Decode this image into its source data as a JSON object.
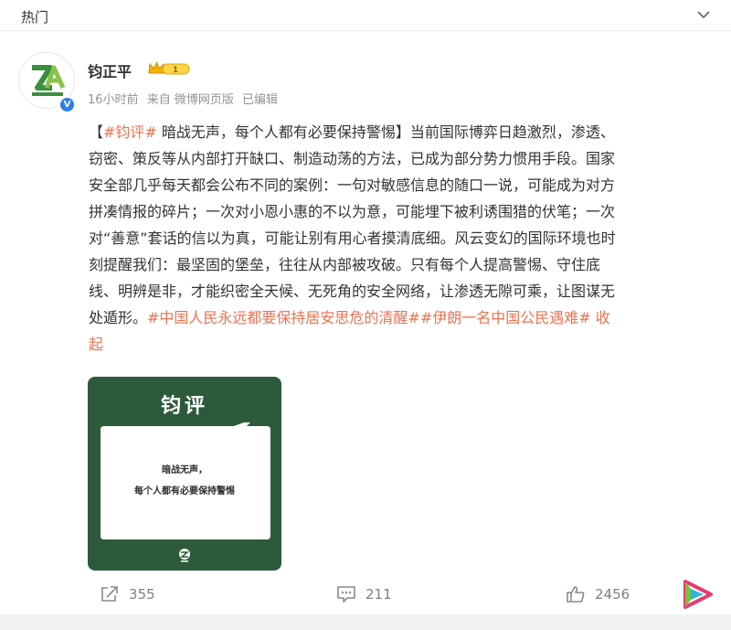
{
  "header": {
    "tab_label": "热门"
  },
  "post": {
    "author": "钧正平",
    "vip_level": "1",
    "meta": {
      "time": "16小时前",
      "source": "来自 微博网页版",
      "edited": "已编辑"
    },
    "content_lines": [
      [
        {
          "t": "【",
          "c": ""
        },
        {
          "t": "#钧评#",
          "c": "orange"
        },
        {
          "t": " 暗战无声，每个人都有必要保持警惕】当前国际博弈日趋激烈，渗透、",
          "c": ""
        }
      ],
      [
        {
          "t": "窃密、策反等从内部打开缺口、制造动荡的方法，已成为部分势力惯用手段。国家",
          "c": ""
        }
      ],
      [
        {
          "t": "安全部几乎每天都会公布不同的案例：一句对敏感信息的随口一说，可能成为对方",
          "c": ""
        }
      ],
      [
        {
          "t": "拼凑情报的碎片；一次对小恩小惠的不以为意，可能埋下被利诱围猎的伏笔；一次",
          "c": ""
        }
      ],
      [
        {
          "t": "对“善意”套话的信以为真，可能让别有用心者摸清底细。风云变幻的国际环境也时",
          "c": ""
        }
      ],
      [
        {
          "t": "刻提醒我们：最坚固的堡垒，往往从内部被攻破。只有每个人提高警惕、守住底",
          "c": ""
        }
      ],
      [
        {
          "t": "线、明辨是非，才能织密全天候、无死角的安全网络，让渗透无隙可乘，让图谋无",
          "c": ""
        }
      ],
      [
        {
          "t": "处遁形。",
          "c": ""
        },
        {
          "t": "#中国人民永远都要保持居安思危的清醒##伊朗一名中国公民遇难#",
          "c": "orange"
        },
        {
          "t": " 收",
          "c": "orange"
        }
      ],
      [
        {
          "t": "起",
          "c": "orange"
        }
      ]
    ],
    "image": {
      "title": "钧评",
      "line1": "暗战无声，",
      "line2": "每个人都有必要保持警惕"
    },
    "actions": {
      "shares": "355",
      "comments": "211",
      "likes": "2456"
    }
  },
  "colors": {
    "accent": "#eb7350",
    "verified": "#2b7de9",
    "card_bg": "#2c5a3b",
    "avatar_green": "#3a8f3e"
  },
  "icons": [
    "chevron-down-icon",
    "crown-icon",
    "verified-icon",
    "share-icon",
    "comment-icon",
    "like-icon",
    "brand-logo-icon"
  ]
}
